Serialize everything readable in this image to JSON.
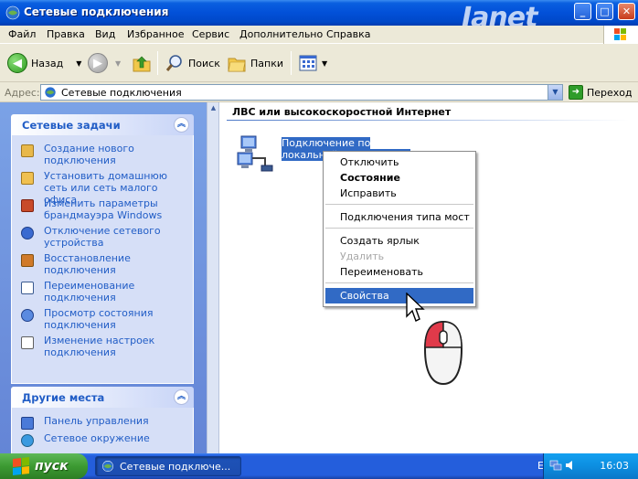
{
  "window": {
    "title": "Сетевые подключения",
    "brand": "Ianet",
    "controls": {
      "minimize": "_",
      "maximize": "□",
      "close": "✕"
    }
  },
  "menu": {
    "file": "Файл",
    "edit": "Правка",
    "view": "Вид",
    "favorites": "Избранное",
    "service": "Сервис",
    "advanced": "Дополнительно",
    "help": "Справка"
  },
  "toolbar": {
    "back": "Назад",
    "search": "Поиск",
    "folders": "Папки"
  },
  "address": {
    "label": "Адрес:",
    "value": "Сетевые подключения",
    "go": "Переход"
  },
  "sidebar": {
    "network_tasks": {
      "title": "Сетевые задачи",
      "items": [
        "Создание нового подключения",
        "Установить домашнюю сеть или сеть малого офиса",
        "Изменить параметры брандмауэра Windows",
        "Отключение сетевого устройства",
        "Восстановление подключения",
        "Переименование подключения",
        "Просмотр состояния подключения",
        "Изменение настроек подключения"
      ]
    },
    "other_places": {
      "title": "Другие места",
      "items": [
        "Панель управления",
        "Сетевое окружение"
      ]
    }
  },
  "content": {
    "group_title": "ЛВС или высокоскоростной Интернет",
    "connection_label": "Подключение по локальной сети Подклю"
  },
  "context_menu": {
    "items": {
      "disconnect": "Отключить",
      "status": "Состояние",
      "repair": "Исправить",
      "bridge": "Подключения типа мост",
      "shortcut": "Создать ярлык",
      "delete": "Удалить",
      "rename": "Переименовать",
      "properties": "Свойства"
    }
  },
  "taskbar": {
    "start": "пуск",
    "task": "Сетевые подключе...",
    "lang": "EN",
    "time": "16:03"
  },
  "colors": {
    "titlebar": "#0250d8",
    "highlight": "#316ac5",
    "link": "#215dc6",
    "start_green": "#3c9a32"
  }
}
